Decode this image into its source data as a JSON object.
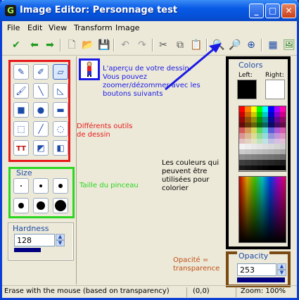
{
  "window": {
    "title": "Image Editor: Personnage test",
    "minimize": "_",
    "maximize": "□",
    "close": "✕"
  },
  "menu": [
    "File",
    "Edit",
    "View",
    "Transform",
    "Image"
  ],
  "toolbar_icons": [
    "check-icon",
    "arrow-left-icon",
    "arrow-right-icon",
    "new-icon",
    "open-icon",
    "save-icon",
    "undo-icon",
    "redo-icon",
    "cut-icon",
    "copy-icon",
    "paste-icon",
    "zoom-in-icon",
    "zoom-out-icon",
    "zoom-fit-icon",
    "grid-icon",
    "image-icon"
  ],
  "tools": [
    {
      "name": "pencil-tool",
      "glyph": "✎"
    },
    {
      "name": "color-picker-tool",
      "glyph": "✐"
    },
    {
      "name": "eraser-tool",
      "glyph": "▱"
    },
    {
      "name": "brush-tool",
      "glyph": "🖌"
    },
    {
      "name": "line-tool",
      "glyph": "╲"
    },
    {
      "name": "polygon-tool",
      "glyph": "◺"
    },
    {
      "name": "rectangle-tool",
      "glyph": "■"
    },
    {
      "name": "ellipse-tool",
      "glyph": "●"
    },
    {
      "name": "rounded-rect-tool",
      "glyph": "▬"
    },
    {
      "name": "select-rect-tool",
      "glyph": "⬚"
    },
    {
      "name": "magic-wand-tool",
      "glyph": "╱"
    },
    {
      "name": "select-ellipse-tool",
      "glyph": "◌"
    },
    {
      "name": "text-tool",
      "glyph": "TT"
    },
    {
      "name": "fill-tool",
      "glyph": "◩"
    },
    {
      "name": "replace-color-tool",
      "glyph": "◧"
    }
  ],
  "annotations": {
    "preview": "L'aperçu de votre dessin. Vous pouvez zoomer/dézommer avec les boutons suivants",
    "tools": "Différents outils de dessin",
    "size": "Taille du pinceau",
    "colors": "Les couleurs qui peuvent être utilisées pour colorier",
    "opacity": "Opacité = transparence"
  },
  "size": {
    "label": "Size"
  },
  "hardness": {
    "label": "Hardness",
    "value": "128"
  },
  "colors": {
    "label": "Colors",
    "left_label": "Left:",
    "right_label": "Right:",
    "left_color": "#000000",
    "right_color": "#ffffff"
  },
  "opacity": {
    "label": "Opacity",
    "value": "253"
  },
  "status": {
    "message": "Erase with the mouse (based on transparency)",
    "coords": "(0,0)",
    "zoom": "Zoom: 100%"
  },
  "accent": {
    "tools_box": "#e8191b",
    "size_box": "#2bd621",
    "preview_box": "#1a1ae6",
    "colors_box": "#000000",
    "opacity_box": "#7a4a12"
  }
}
